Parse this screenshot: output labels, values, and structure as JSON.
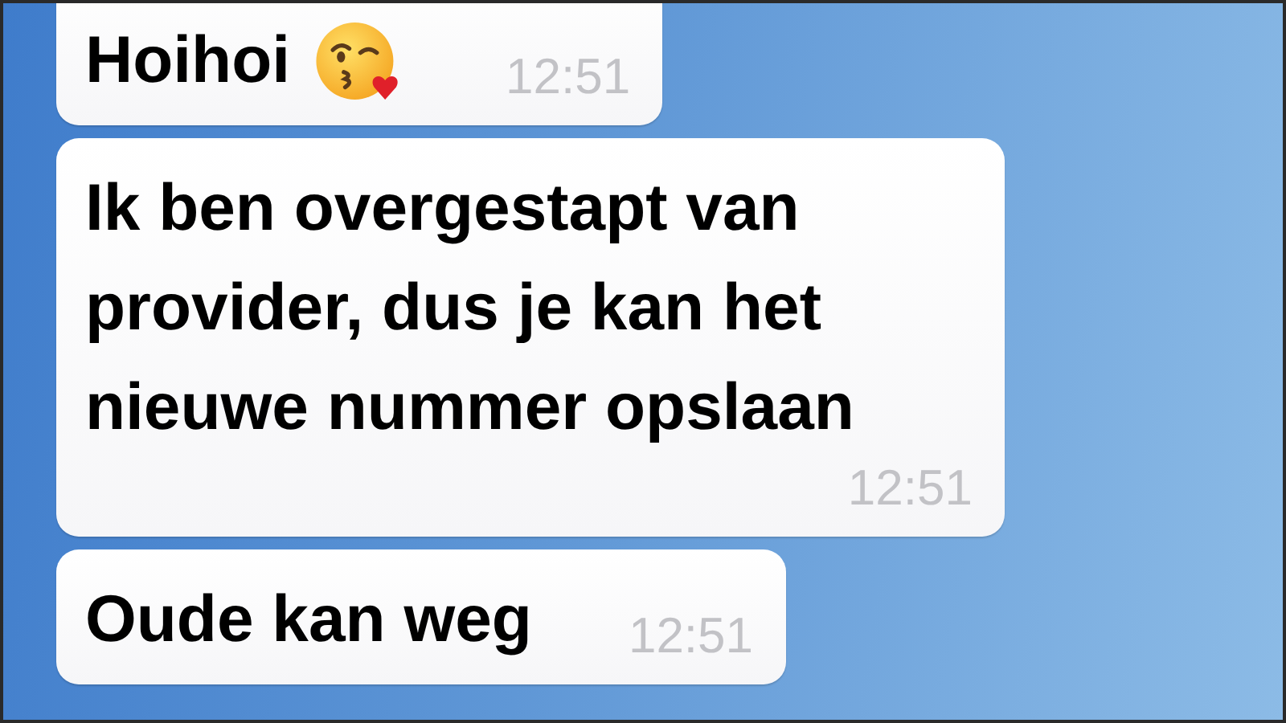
{
  "messages": [
    {
      "kind": "with_emoji",
      "text": "Hoihoi",
      "time": "12:51"
    },
    {
      "kind": "plain",
      "text": "Ik ben overgestapt van provider, dus je kan het nieuwe nummer opslaan",
      "time": "12:51"
    },
    {
      "kind": "plain",
      "text": "Oude kan weg",
      "time": "12:51"
    }
  ]
}
